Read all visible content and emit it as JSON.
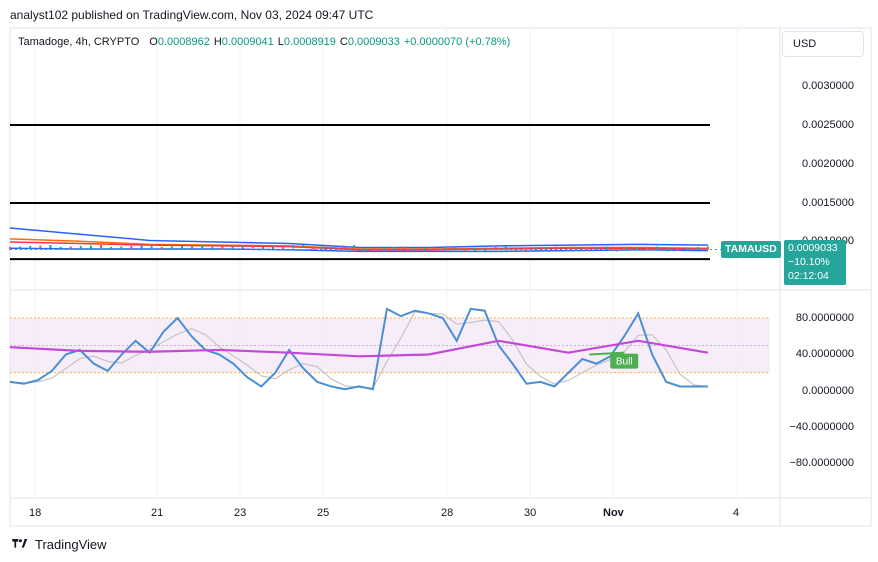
{
  "publish_line": "analyst102 published on TradingView.com, Nov 03, 2024 09:47 UTC",
  "legend": {
    "symbol": "Tamadoge, 4h, CRYPTO",
    "o_label": "O",
    "o_value": "0.0008962",
    "h_label": "H",
    "h_value": "0.0009041",
    "l_label": "L",
    "l_value": "0.0008919",
    "c_label": "C",
    "c_value": "0.0009033",
    "change": "+0.0000070 (+0.78%)"
  },
  "currency_button": "USD",
  "price_axis": [
    "0.0030000",
    "0.0025000",
    "0.0020000",
    "0.0015000",
    "0.0010000"
  ],
  "osc_axis": [
    "80.0000000",
    "40.0000000",
    "0.0000000",
    "−40.0000000",
    "−80.0000000"
  ],
  "price_tag": {
    "symbol": "TAMAUSD",
    "price": "0.0009033",
    "change_pct": "−10.10%",
    "countdown": "02:12:04"
  },
  "bull_label": "Bull",
  "x_axis": [
    "18",
    "21",
    "23",
    "25",
    "28",
    "30",
    "Nov",
    "4"
  ],
  "footer_brand": "TradingView",
  "colors": {
    "up": "#26a69a",
    "bb_upper": "#2962ff",
    "bb_lower": "#2962ff",
    "ema_orange": "#ff6d00",
    "ema_red": "#f23645",
    "stoch_k": "#4a8fd6",
    "stoch_d": "#c4c4c4",
    "rsi": "#c349d8",
    "rsi_band": "#f3e5f5",
    "bull": "#4caf50"
  },
  "chart_data": [
    {
      "type": "line",
      "title": "Tamadoge, 4h, CRYPTO",
      "ylim": [
        0.0007,
        0.0033
      ],
      "horizontal_lines": [
        0.0025,
        0.0015,
        0.00078
      ],
      "series": [
        {
          "name": "",
          "x": [
            0,
            10,
            20,
            30,
            40,
            50,
            60,
            70,
            80,
            90,
            100
          ],
          "values": [
            0.00118,
            0.0011,
            0.00102,
            0.001,
            0.00098,
            0.00093,
            0.00093,
            0.00095,
            0.00096,
            0.00097,
            0.00096
          ]
        },
        {
          "name": "",
          "x": [
            0,
            10,
            20,
            30,
            40,
            50,
            60,
            70,
            80,
            90,
            100
          ],
          "values": [
            0.00092,
            0.00091,
            0.00091,
            0.00091,
            0.0009,
            0.00088,
            0.00088,
            0.00088,
            0.00089,
            0.0009,
            0.00089
          ]
        },
        {
          "name": "",
          "x": [
            0,
            10,
            20,
            30,
            40,
            50,
            60,
            70,
            80,
            90,
            100
          ],
          "values": [
            0.00104,
            0.00101,
            0.00097,
            0.00096,
            0.00095,
            0.00091,
            0.00091,
            0.00092,
            0.00093,
            0.00093,
            0.00092
          ]
        },
        {
          "name": "",
          "x": [
            0,
            10,
            20,
            30,
            40,
            50,
            60,
            70,
            80,
            90,
            100
          ],
          "values": [
            0.001,
            0.00098,
            0.00096,
            0.00095,
            0.00094,
            0.0009,
            0.0009,
            0.00091,
            0.00092,
            0.00092,
            0.00091
          ]
        }
      ]
    },
    {
      "type": "line",
      "ylim": [
        -100,
        100
      ],
      "bands": [
        20,
        80
      ],
      "series": [
        {
          "name": "",
          "x": [
            0,
            2,
            4,
            6,
            8,
            10,
            12,
            14,
            16,
            18,
            20,
            22,
            24,
            26,
            28,
            30,
            32,
            34,
            36,
            38,
            40,
            42,
            44,
            46,
            48,
            50,
            52,
            54,
            56,
            58,
            60,
            62,
            64,
            66,
            68,
            70,
            72,
            74,
            76,
            78,
            80,
            82,
            84,
            86,
            88,
            90,
            92,
            94,
            96,
            98,
            100
          ],
          "values": [
            10,
            8,
            12,
            22,
            40,
            45,
            30,
            22,
            40,
            55,
            42,
            65,
            80,
            60,
            45,
            40,
            30,
            15,
            5,
            20,
            45,
            25,
            10,
            5,
            2,
            5,
            2,
            90,
            82,
            88,
            85,
            80,
            55,
            90,
            88,
            50,
            30,
            8,
            10,
            5,
            20,
            35,
            30,
            38,
            60,
            85,
            40,
            10,
            5,
            5,
            5
          ]
        },
        {
          "name": "",
          "x": [
            0,
            10,
            20,
            30,
            40,
            50,
            60,
            70,
            80,
            90,
            100
          ],
          "values": [
            48,
            44,
            43,
            45,
            42,
            38,
            40,
            55,
            42,
            55,
            42
          ]
        }
      ]
    }
  ]
}
